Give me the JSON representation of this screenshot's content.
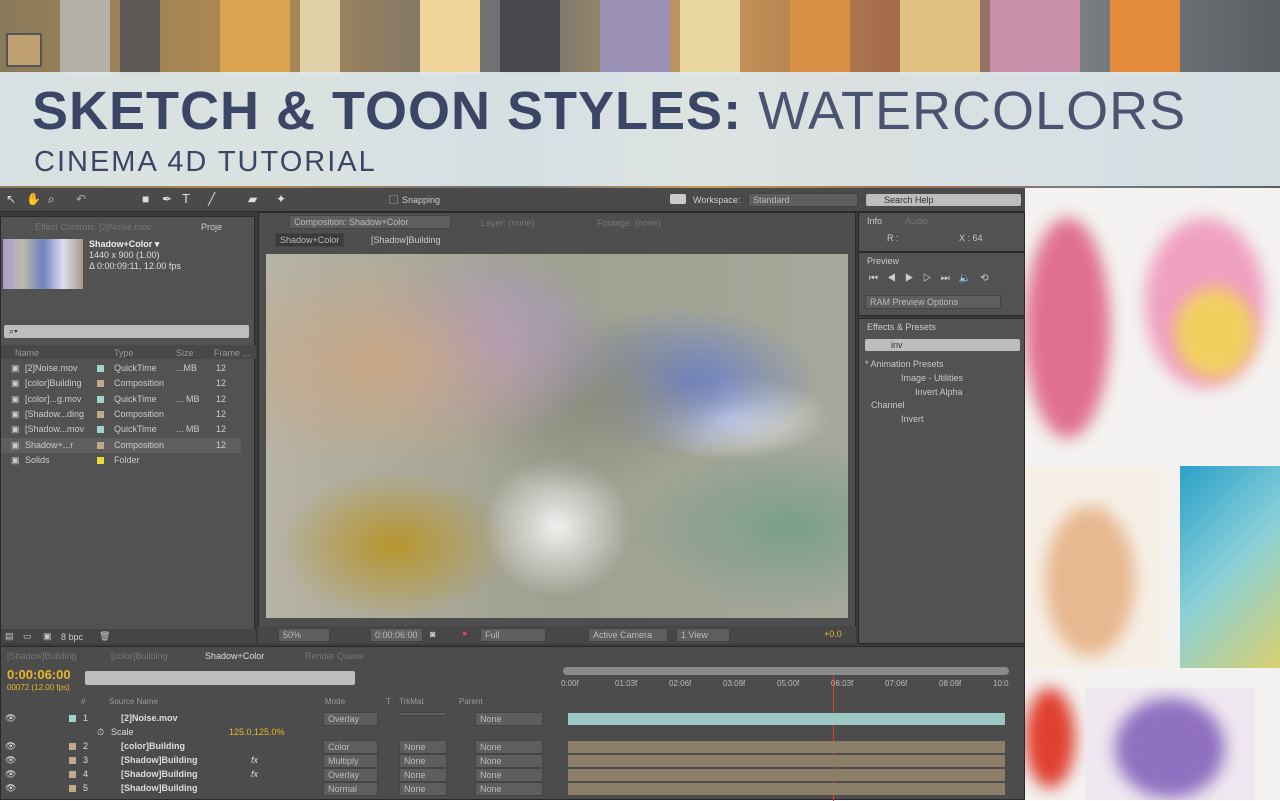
{
  "banner": {
    "title_bold": "SKETCH & TOON STYLES:",
    "title_thin": "WATERCOLORS",
    "subtitle": "CINEMA 4D TUTORIAL"
  },
  "toolbar": {
    "snapping": "Snapping",
    "workspace_label": "Workspace:",
    "workspace": "Standard",
    "search_help": "Search Help"
  },
  "project": {
    "tab_effect": "Effect Controls: [2]Noise.mov",
    "tab_project": "Proje",
    "comp_name": "Shadow+Color ▾",
    "comp_size": "1440 x 900 (1.00)",
    "comp_duration": "Δ 0:00:09:11, 12.00 fps",
    "search_placeholder": "⌕▾",
    "columns": [
      "Name",
      "Type",
      "Size",
      "Frame ..."
    ],
    "items": [
      {
        "name": "[2]Noise.mov",
        "type": "QuickTime",
        "size": "...MB",
        "frame": "12",
        "color": "#9fd4cc"
      },
      {
        "name": "[color]Building",
        "type": "Composition",
        "size": "",
        "frame": "12",
        "color": "#c2a98a"
      },
      {
        "name": "[color]...g.mov",
        "type": "QuickTime",
        "size": "... MB",
        "frame": "12",
        "color": "#9fd4cc"
      },
      {
        "name": "[Shadow...ding",
        "type": "Composition",
        "size": "",
        "frame": "12",
        "color": "#c2a98a"
      },
      {
        "name": "[Shadow...mov",
        "type": "QuickTime",
        "size": "... MB",
        "frame": "12",
        "color": "#9fd4cc"
      },
      {
        "name": "Shadow+...r",
        "type": "Composition",
        "size": "",
        "frame": "12",
        "color": "#c2a98a"
      },
      {
        "name": "Solids",
        "type": "Folder",
        "size": "",
        "frame": "",
        "color": "#e8d83a"
      }
    ],
    "bpc": "8 bpc"
  },
  "comp": {
    "tab": "Composition: Shadow+Color",
    "layer": "Layer: (none)",
    "footage": "Footage: (none)",
    "crumb1": "Shadow+Color",
    "crumb2": "[Shadow]Building",
    "zoom": "50%",
    "time": "0:00:06:00",
    "resolution": "Full",
    "camera": "Active Camera",
    "views": "1 View",
    "exposure": "+0.0"
  },
  "info": {
    "tab": "Info",
    "tab2": "Audio",
    "r": "R :",
    "x": "X : 64"
  },
  "preview": {
    "tab": "Preview",
    "ram": "RAM Preview Options"
  },
  "effects": {
    "tab": "Effects & Presets",
    "search": "inv",
    "tree": [
      "* Animation Presets",
      "Image - Utilities",
      "Invert Alpha",
      "Channel",
      "Invert"
    ]
  },
  "timeline": {
    "tabs": [
      "[Shadow]Building",
      "[color]Building",
      "Shadow+Color",
      "Render Queue"
    ],
    "timecode": "0:00:06:00",
    "frames": "00072 (12.00 fps)",
    "columns": {
      "num": "#",
      "source": "Source Name",
      "mode": "Mode",
      "t": "T",
      "trkmat": "TrkMat",
      "parent": "Parent"
    },
    "ruler": [
      "0:00f",
      "01:03f",
      "02:06f",
      "03:09f",
      "05:00f",
      "06:03f",
      "07:06f",
      "08:09f",
      "10:0"
    ],
    "layers": [
      {
        "num": "1",
        "name": "[2]Noise.mov",
        "mode": "Overlay",
        "trkmat": "",
        "parent": "None",
        "fx": ""
      },
      {
        "num": "2",
        "name": "[color]Building",
        "mode": "Color",
        "trkmat": "None",
        "parent": "None",
        "fx": ""
      },
      {
        "num": "3",
        "name": "[Shadow]Building",
        "mode": "Multiply",
        "trkmat": "None",
        "parent": "None",
        "fx": "fx"
      },
      {
        "num": "4",
        "name": "[Shadow]Building",
        "mode": "Overlay",
        "trkmat": "None",
        "parent": "None",
        "fx": "fx"
      },
      {
        "num": "5",
        "name": "[Shadow]Building",
        "mode": "Normal",
        "trkmat": "None",
        "parent": "None",
        "fx": ""
      }
    ],
    "scale_label": "Scale",
    "scale_value": "125.0,125.0%"
  },
  "colors": {
    "accent": "#e8b82a",
    "banner_text": "#3b4565",
    "panel": "#525252"
  }
}
